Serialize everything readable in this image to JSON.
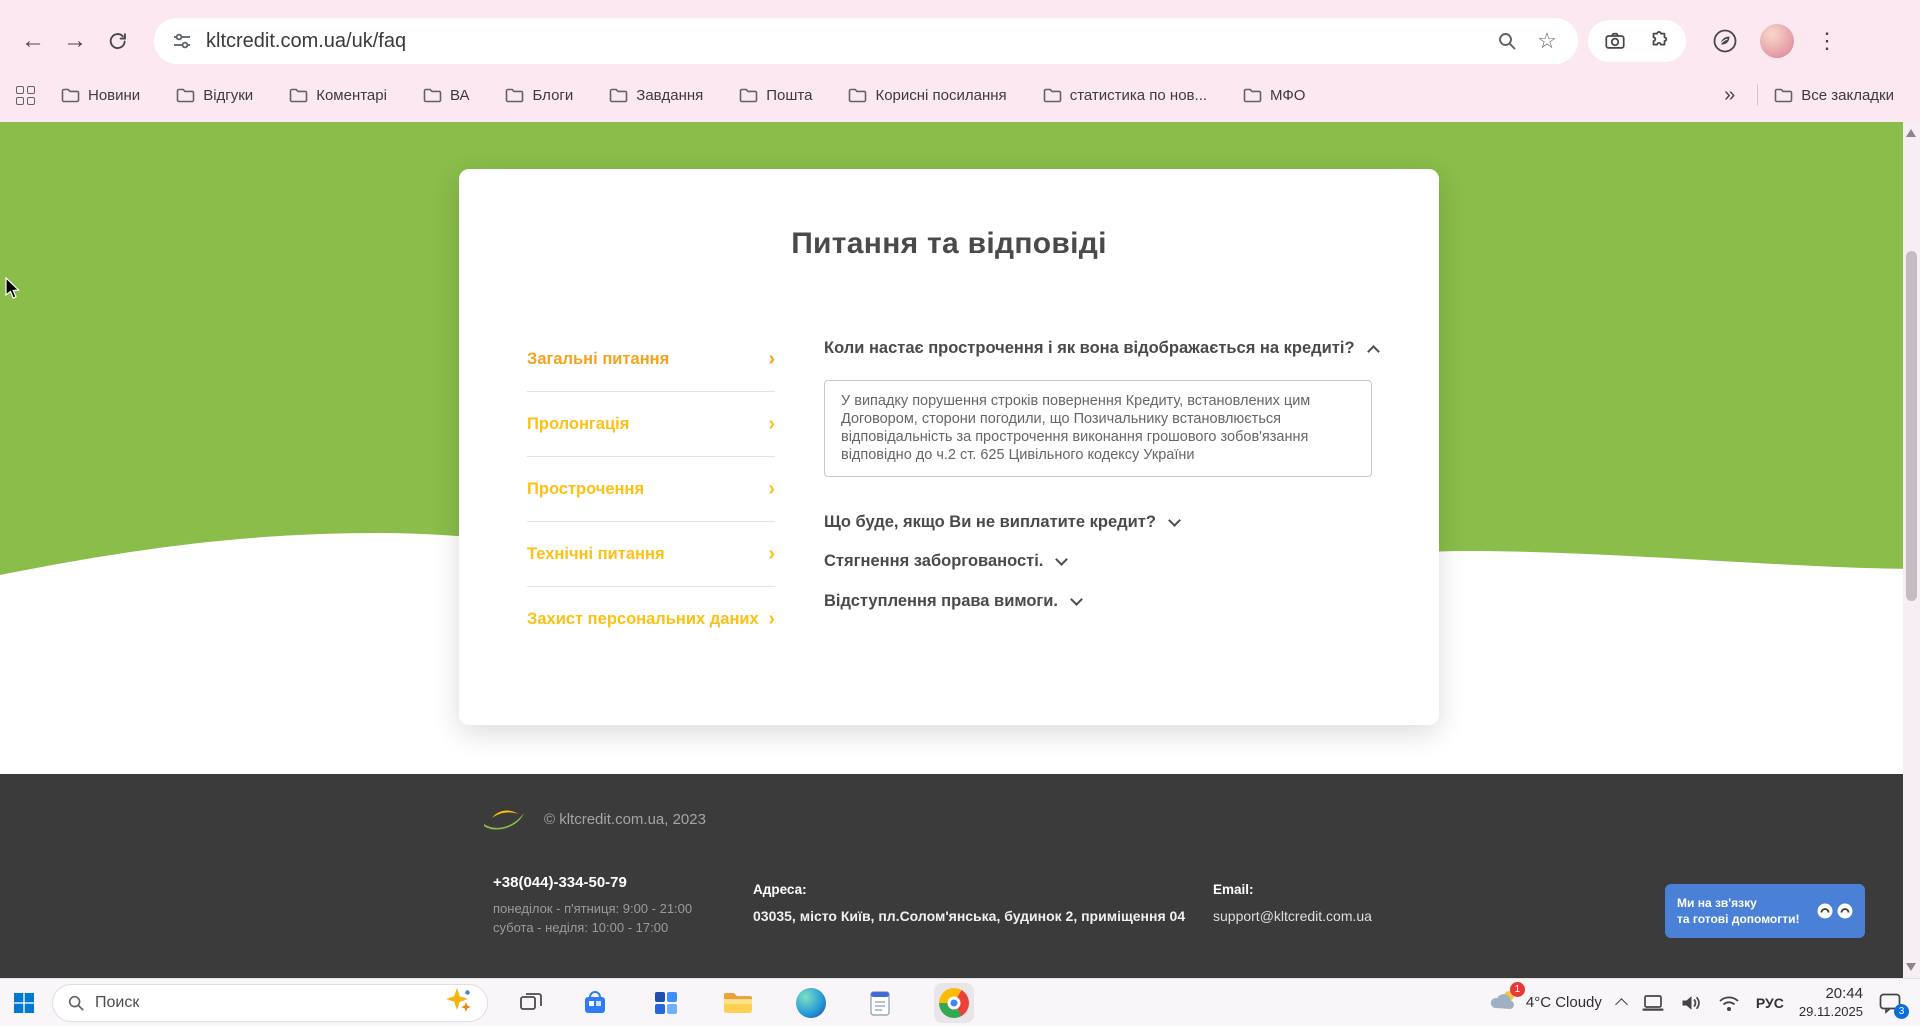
{
  "browser": {
    "url": "kltcredit.com.ua/uk/faq",
    "back_glyph": "←",
    "forward_glyph": "→",
    "dots_glyph": "⋮",
    "star_glyph": "☆",
    "overflow_glyph": "»",
    "all_bookmarks": "Все закладки",
    "bookmarks": [
      "Новини",
      "Відгуки",
      "Коментарі",
      "ВА",
      "Блоги",
      "Завдання",
      "Пошта",
      "Корисні посилання",
      "статистика по нов...",
      "МФО"
    ]
  },
  "page": {
    "title": "Питання та відповіді",
    "menu_chevron": "›",
    "menu": [
      {
        "label": "Загальні питання"
      },
      {
        "label": "Пролонгація"
      },
      {
        "label": "Прострочення"
      },
      {
        "label": "Технічні питання"
      },
      {
        "label": "Захист персональних даних"
      }
    ],
    "faq": {
      "q1": "Коли настає прострочення і як вона відображається на кредиті?",
      "a1": "У випадку порушення строків повернення Кредиту, встановлених цим Договором, сторони погодили, що Позичальнику встановлюється відповідальність за прострочення виконання грошового зобов'язання відповідно до ч.2 ст. 625 Цивільного кодексу України",
      "q2": "Що буде, якщо Ви не виплатите кредит?",
      "q3": "Стягнення заборгованості.",
      "q4": "Відступлення права вимоги."
    },
    "footer": {
      "copyright": "© kltcredit.com.ua, 2023",
      "phone": "+38(044)-334-50-79",
      "hours1": "понеділок - п'ятниця: 9:00 - 21:00",
      "hours2": "субота - неділя: 10:00 - 17:00",
      "address_label": "Адреса:",
      "address": "03035, місто Київ, пл.Солом'янська, будинок 2, приміщення 04",
      "email_label": "Email:",
      "email": "support@kltcredit.com.ua",
      "chat_line1": "Ми на зв'язку",
      "chat_line2": "та готові допомогти!"
    }
  },
  "taskbar": {
    "search_placeholder": "Поиск",
    "weather": "4°C Cloudy",
    "weather_badge": "1",
    "lang": "РУС",
    "time": "20:44",
    "date": "29.11.2025",
    "notification_badge": "3"
  },
  "colors": {
    "theme_pink": "#fce8f1",
    "page_green": "#8abd4a",
    "menu_yellow": "#fdc113",
    "menu_active_orange": "#f7a21b",
    "footer_bg": "#3b3b3b",
    "chat_blue": "#4a80d6"
  }
}
